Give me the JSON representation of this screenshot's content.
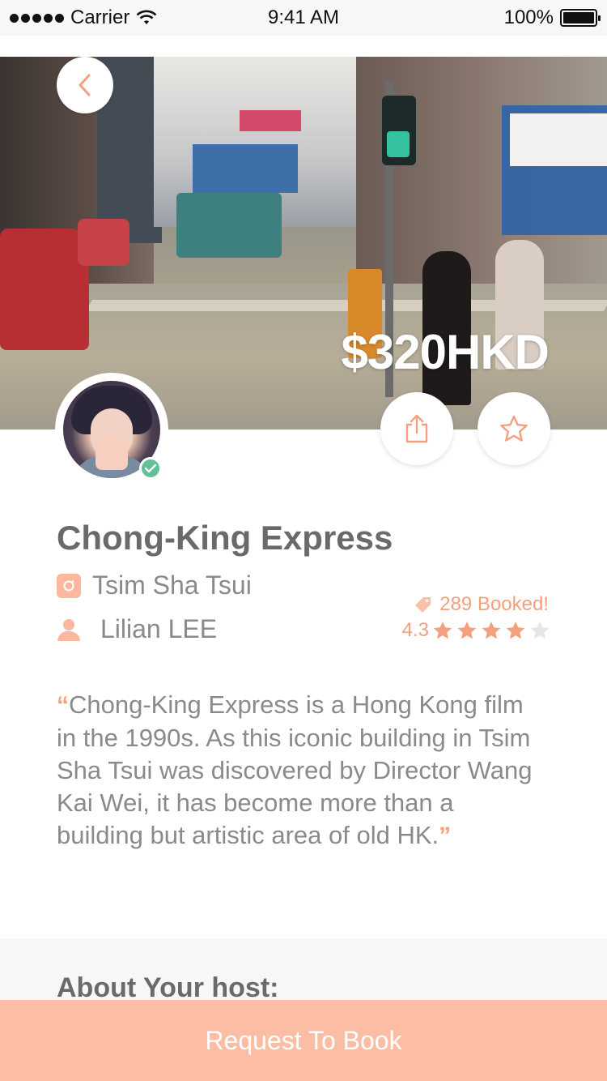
{
  "status_bar": {
    "carrier": "Carrier",
    "time": "9:41 AM",
    "battery": "100%"
  },
  "hero": {
    "price": "$320HKD"
  },
  "listing": {
    "title": "Chong-King Express",
    "location": "Tsim Sha Tsui",
    "host_name": "Lilian LEE",
    "booked": "289 Booked!",
    "rating_value": "4.3",
    "stars_filled": 4,
    "stars_total": 5,
    "quote_open": "“",
    "description": "Chong-King Express is a Hong Kong film in the 1990s. As this iconic building in Tsim Sha Tsui was discovered by Director Wang Kai Wei, it has become more than a building but artistic area of old HK.",
    "quote_close": "”"
  },
  "about": {
    "heading": "About Your host:"
  },
  "cta": {
    "label": "Request To Book"
  },
  "colors": {
    "accent": "#f4a07f",
    "cta_bg": "#fbbea5",
    "verified": "#63bf95"
  },
  "icons": {
    "back": "chevron-left-icon",
    "share": "share-icon",
    "favorite": "star-outline-icon",
    "location": "camera-icon",
    "host": "person-icon",
    "tag": "tag-icon",
    "star": "star-icon"
  }
}
